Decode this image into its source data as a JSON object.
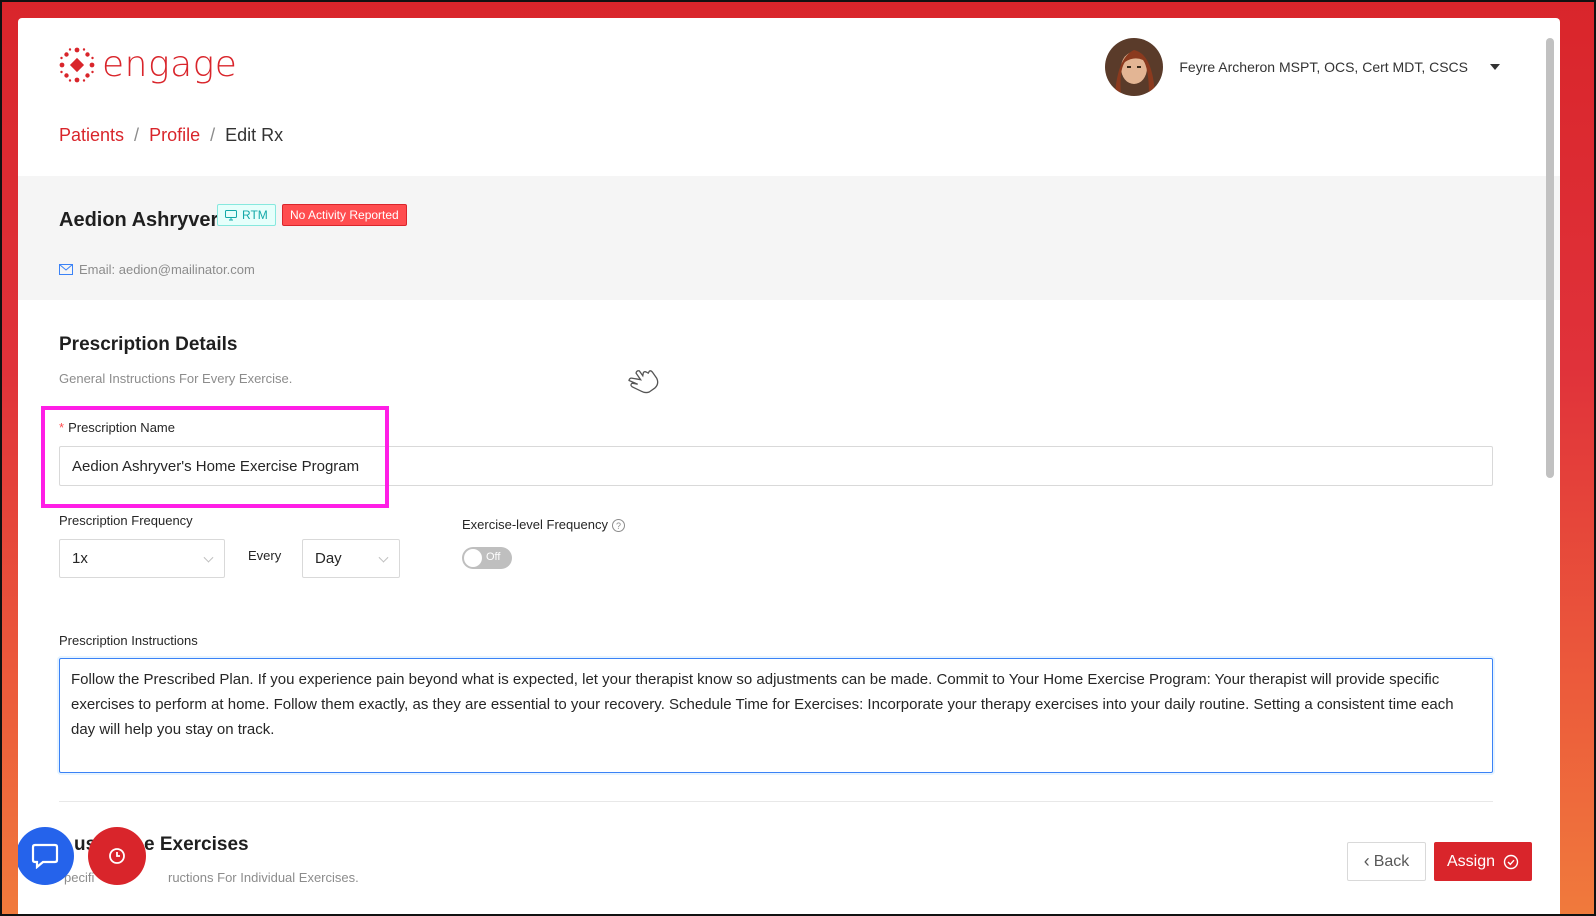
{
  "header": {
    "logo_text": "engage",
    "user_name": "Feyre Archeron MSPT, OCS, Cert MDT, CSCS",
    "icons": {
      "logo": "engage-logo-icon",
      "avatar": "avatar",
      "caret": "caret-down-icon"
    }
  },
  "breadcrumb": {
    "items": [
      "Patients",
      "Profile",
      "Edit Rx"
    ],
    "separator": "/"
  },
  "patient": {
    "name": "Aedion Ashryver",
    "tag_rtm": "RTM",
    "tag_status": "No Activity Reported",
    "email": "Email: aedion@mailinator.com"
  },
  "prescription": {
    "section_title": "Prescription Details",
    "section_subtitle": "General Instructions For Every Exercise.",
    "name_label": "Prescription Name",
    "name_value": "Aedion Ashryver's Home Exercise Program",
    "frequency_label": "Prescription Frequency",
    "frequency_value": "1x",
    "every_label": "Every",
    "period_value": "Day",
    "exercise_freq_label": "Exercise-level Frequency",
    "exercise_freq_toggle": "Off",
    "instructions_label": "Prescription Instructions",
    "instructions_value": "Follow the Prescribed Plan. If you experience pain beyond what is expected, let your therapist know so adjustments can be made. Commit to Your Home Exercise Program: Your therapist will provide specific exercises to perform at home. Follow them exactly, as they are essential to your recovery. Schedule Time for Exercises: Incorporate your therapy exercises into your daily routine. Setting a consistent time each day will help you stay on track."
  },
  "exercises": {
    "section_title_partial": "e Exercises",
    "section_title_left": "us",
    "section_subtitle_left": "pecifi",
    "section_subtitle_right": "ructions For Individual Exercises."
  },
  "actions": {
    "back_label": "Back",
    "assign_label": "Assign"
  },
  "colors": {
    "brand": "#d9252b",
    "highlight": "#ff1ee6",
    "focus": "#3b82f6",
    "chat": "#2563eb"
  }
}
